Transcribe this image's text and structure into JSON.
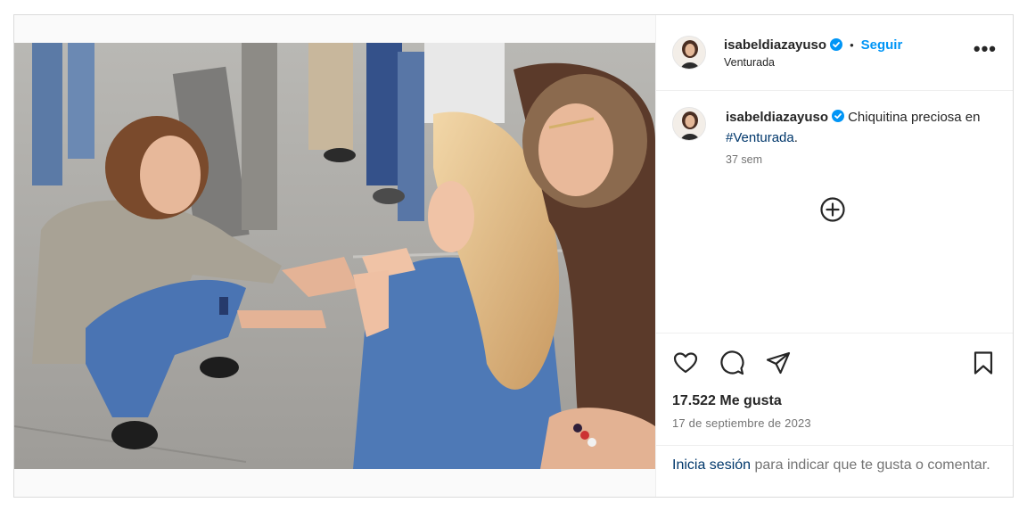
{
  "post": {
    "username": "isabeldiazayuso",
    "follow_label": "Seguir",
    "location": "Venturada",
    "more_label": "•••",
    "separator": "•"
  },
  "caption": {
    "username": "isabeldiazayuso",
    "text_before": "Chiquitina preciosa en ",
    "hashtag": "#Venturada",
    "text_after": ".",
    "age": "37 sem"
  },
  "stats": {
    "likes": "17.522 Me gusta",
    "date": "17 de septiembre de 2023"
  },
  "login": {
    "link": "Inicia sesión",
    "rest": " para indicar que te gusta o comentar."
  },
  "colors": {
    "accent": "#0095f6",
    "verified": "#0095f6",
    "link": "#00376b",
    "muted": "#737373"
  },
  "icons": [
    "verified-badge-icon",
    "more-options-icon",
    "add-comment-icon",
    "heart-icon",
    "comment-icon",
    "share-icon",
    "bookmark-icon"
  ]
}
